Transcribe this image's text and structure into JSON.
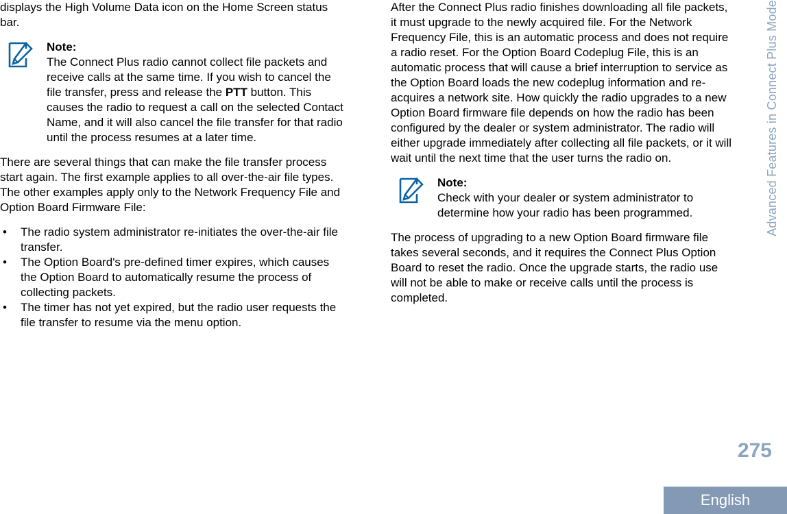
{
  "document": {
    "running_head": "Advanced Features in Connect Plus Mode",
    "page_number": "275",
    "language": "English",
    "accent_color": "#8ca5bf",
    "band_color": "#8499b4",
    "note_icon_color": "#0b63a5",
    "note_icon_name": "note-pencil-document-icon"
  },
  "left_column": {
    "intro_paragraph": "displays the High Volume Data icon on the Home Screen status bar.",
    "note": {
      "title": "Note:",
      "body_before_bold": "The Connect Plus radio cannot collect file packets and receive calls at the same time. If you wish to cancel the file transfer, press and release the ",
      "bold_term": "PTT",
      "body_after_bold": " button. This causes the radio to request a call on the selected Contact Name, and it will also cancel the file transfer for that radio until the process resumes at a later time."
    },
    "body_paragraph": "There are several things that can make the file transfer process start again. The first example applies to all over-the-air file types. The other examples apply only to the Network Frequency File and Option Board Firmware File:",
    "bullet_marker": "•",
    "bullets": [
      "The radio system administrator re-initiates the over-the-air file transfer.",
      "The Option Board's pre-defined timer expires, which causes the Option Board to automatically resume the process of collecting packets.",
      "The timer has not yet expired, but the radio user requests the file transfer to resume via the menu option."
    ]
  },
  "right_column": {
    "paragraph_1": "After the Connect Plus radio finishes downloading all file packets, it must upgrade to the newly acquired file. For the Network Frequency File, this is an automatic process and does not require a radio reset. For the Option Board Codeplug File, this is an automatic process that will cause a brief interruption to service as the Option Board loads the new codeplug information and re-acquires a network site. How quickly the radio upgrades to a new Option Board firmware file depends on how the radio has been configured by the dealer or system administrator. The radio will either upgrade immediately after collecting all file packets, or it will wait until the next time that the user turns the radio on.",
    "note": {
      "title": "Note:",
      "body": "Check with your dealer or system administrator to determine how your radio has been programmed."
    },
    "paragraph_2": "The process of upgrading to a new Option Board firmware file takes several seconds, and it requires the Connect Plus Option Board to reset the radio. Once the upgrade starts, the radio use will not be able to make or receive calls until the process is completed."
  }
}
